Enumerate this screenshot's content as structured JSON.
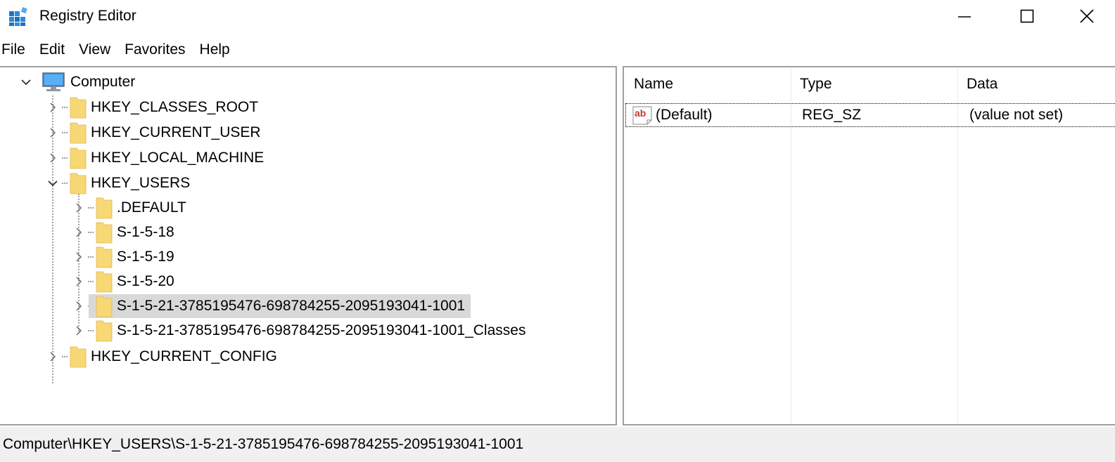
{
  "window": {
    "title": "Registry Editor",
    "icon": "registry-editor-icon",
    "controls": {
      "minimize_icon": "minimize-icon",
      "maximize_icon": "maximize-icon",
      "close_icon": "close-icon"
    }
  },
  "menu": {
    "items": [
      "File",
      "Edit",
      "View",
      "Favorites",
      "Help"
    ]
  },
  "tree": {
    "root": {
      "label": "Computer",
      "icon": "computer-icon",
      "expanded": true
    },
    "hives": [
      {
        "label": "HKEY_CLASSES_ROOT",
        "expanded": false
      },
      {
        "label": "HKEY_CURRENT_USER",
        "expanded": false
      },
      {
        "label": "HKEY_LOCAL_MACHINE",
        "expanded": false
      },
      {
        "label": "HKEY_USERS",
        "expanded": true
      },
      {
        "label": "HKEY_CURRENT_CONFIG",
        "expanded": false
      }
    ],
    "users_children": [
      {
        "label": ".DEFAULT",
        "selected": false
      },
      {
        "label": "S-1-5-18",
        "selected": false
      },
      {
        "label": "S-1-5-19",
        "selected": false
      },
      {
        "label": "S-1-5-20",
        "selected": false
      },
      {
        "label": "S-1-5-21-3785195476-698784255-2095193041-1001",
        "selected": true
      },
      {
        "label": "S-1-5-21-3785195476-698784255-2095193041-1001_Classes",
        "selected": false
      }
    ]
  },
  "values": {
    "columns": [
      "Name",
      "Type",
      "Data"
    ],
    "rows": [
      {
        "icon": "string-value-icon",
        "name": "(Default)",
        "type": "REG_SZ",
        "data": "(value not set)"
      }
    ]
  },
  "status": {
    "path": "Computer\\HKEY_USERS\\S-1-5-21-3785195476-698784255-2095193041-1001"
  },
  "colors": {
    "selection": "#d9d9d9",
    "folder": "#f8d775",
    "status_bar": "#f0f0f0",
    "border": "#a0a0a0"
  }
}
